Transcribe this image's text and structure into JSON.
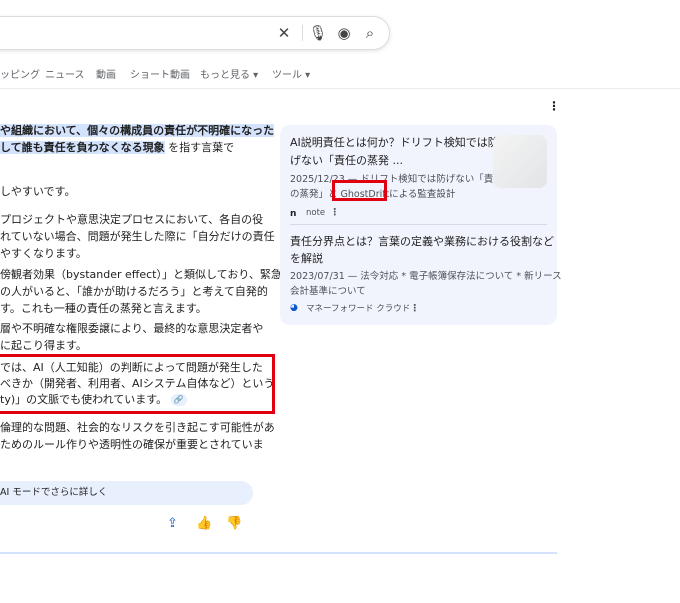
{
  "search": {
    "clear_icon": "close-icon",
    "mic_icon": "mic-icon",
    "lens_icon": "lens-icon",
    "search_icon": "search-icon"
  },
  "tabs": [
    "ッピング",
    "ニュース",
    "動画",
    "ショート動画",
    "もっと見る ▾",
    "ツール ▾"
  ],
  "overview": {
    "lines": [
      "や組織において、個々の構成員の責任が不明確になった",
      "して誰も責任を負わなくなる現象",
      "を指す言葉で",
      "しやすいです。",
      "プロジェクトや意思決定プロセスにおいて、各自の役",
      "れていない場合、問題が発生した際に「自分だけの責任",
      "やすくなります。",
      "傍観者効果（bystander effect）」と類似しており、緊急",
      "の人がいると、「誰かが助けるだろう」と考えて自発的",
      "す。これも一種の責任の蒸発と言えます。",
      "層や不明確な権限委譲により、最終的な意思決定者や",
      "に起こり得ます。",
      "では、AI（人工知能）の判断によって問題が発生した",
      "べきか（開発者、利用者、AIシステム自体など）という",
      "ty)」の文脈でも使われています。",
      "倫理的な問題、社会的なリスクを引き起こす可能性があ",
      "ためのルール作りや透明性の確保が重要とされていま"
    ],
    "ai_mode_button": "AI モードでさらに詳しく"
  },
  "sources": [
    {
      "title1": "AI説明責任とは何か？ドリフト検知では防",
      "title2": "げない「責任の蒸発 ...",
      "snip1": "2025/12/23 — ドリフト検知では防げない「責任",
      "snip2": "の蒸発」と GhostDriftによる監査設計",
      "site": "note"
    },
    {
      "title1": "責任分界点とは？言葉の定義や業務における役割など",
      "title2": "を解説",
      "snip1": "2023/07/31 — 法令対応 * 電子帳簿保存法について * 新リース",
      "snip2": "会計基準について",
      "site": "マネーフォワード クラウド"
    }
  ]
}
